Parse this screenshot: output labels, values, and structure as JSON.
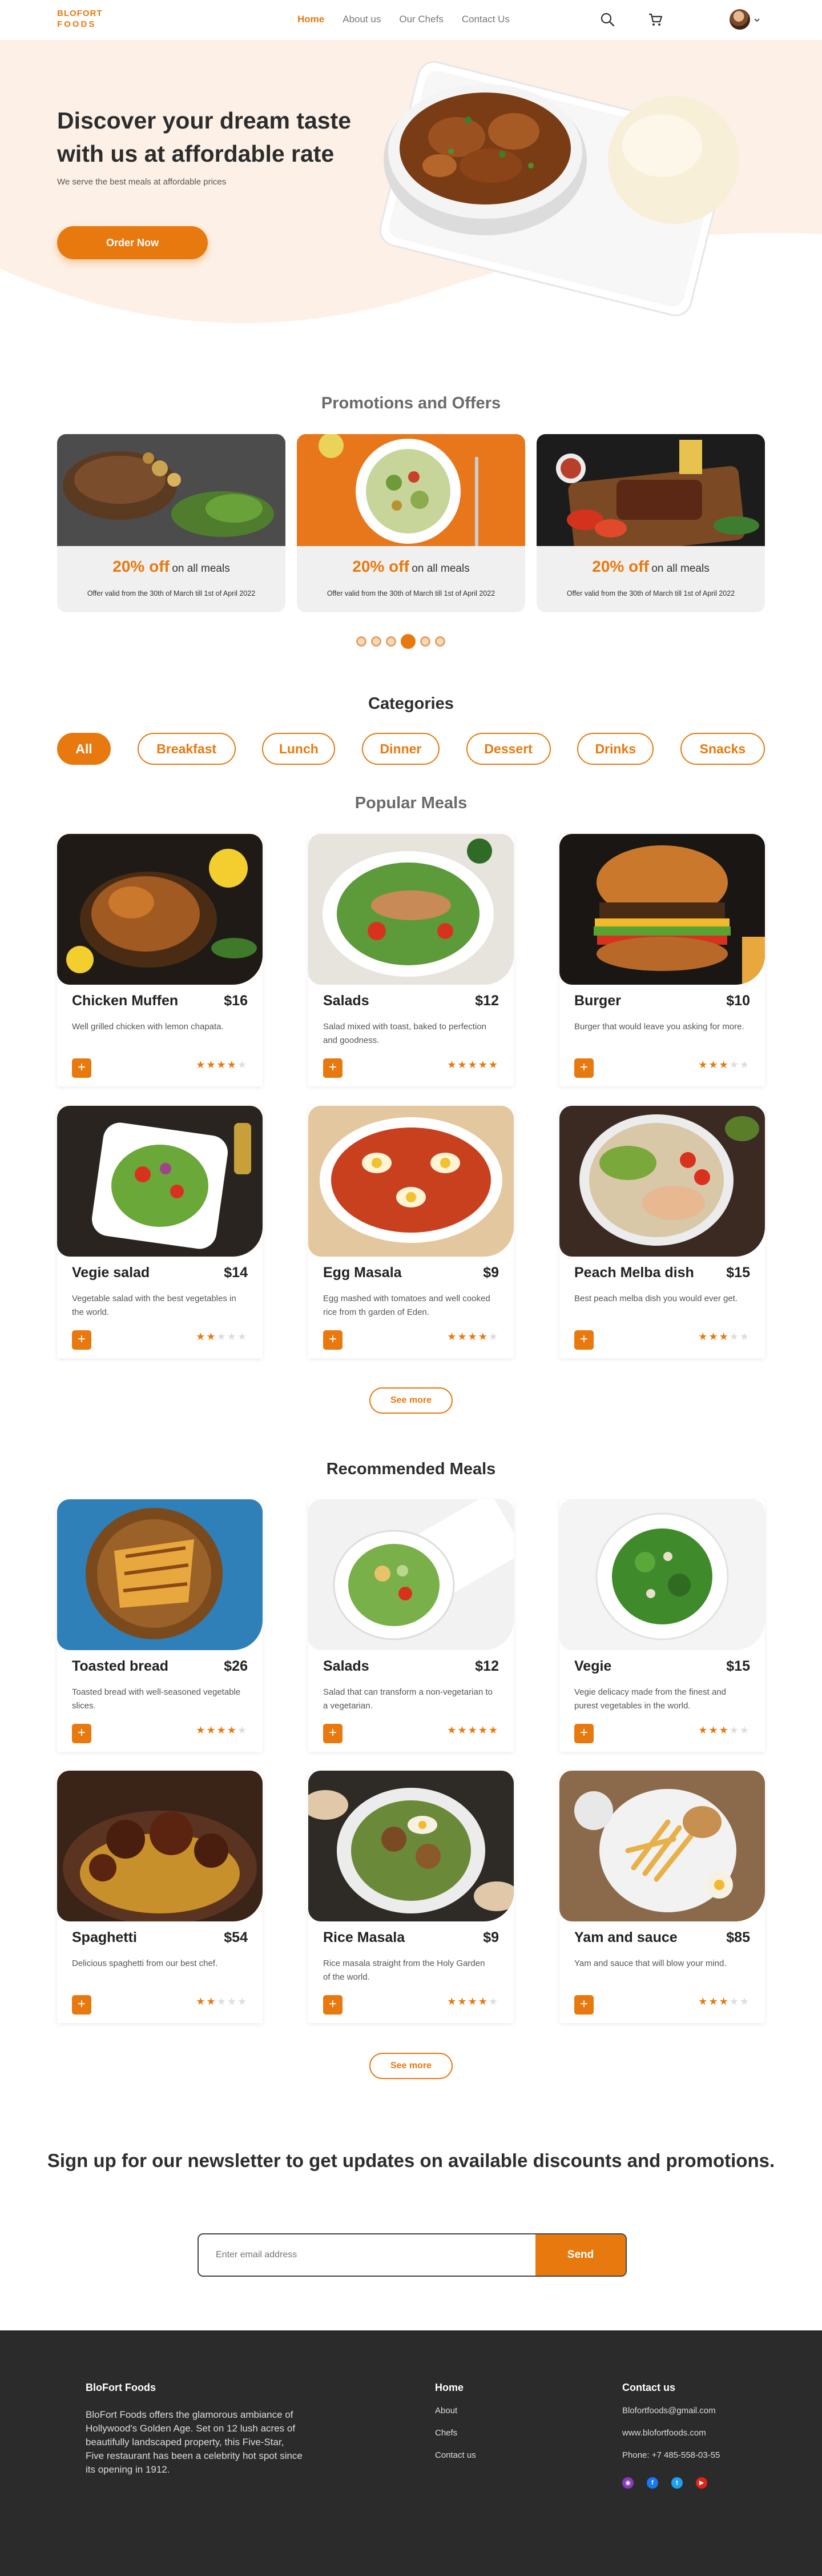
{
  "nav": {
    "logo_line1": "BLOFORT",
    "logo_line2": "FOODS",
    "links": [
      "Home",
      "About us",
      "Our Chefs",
      "Contact Us"
    ],
    "active": "Home"
  },
  "hero": {
    "title": "Discover your dream taste with us at affordable rate",
    "subtitle": "We serve the best meals at affordable prices",
    "button": "Order Now"
  },
  "promotions": {
    "title": "Promotions and Offers",
    "items": [
      {
        "percent": "20% off",
        "label": "on all meals",
        "valid": "Offer valid from the 30th of March till 1st of April 2022"
      },
      {
        "percent": "20% off",
        "label": "on all meals",
        "valid": "Offer valid from the 30th of March till 1st of April 2022"
      },
      {
        "percent": "20% off",
        "label": "on all meals",
        "valid": "Offer valid from the 30th of March till 1st of April 2022"
      }
    ],
    "slide_count": 6,
    "active_slide": 4
  },
  "categories": {
    "title": "Categories",
    "items": [
      "All",
      "Breakfast",
      "Lunch",
      "Dinner",
      "Dessert",
      "Drinks",
      "Snacks"
    ],
    "active": "All"
  },
  "popular": {
    "title": "Popular Meals",
    "see_more": "See more",
    "items": [
      {
        "name": "Chicken Muffen",
        "price": "$16",
        "desc": "Well grilled chicken with lemon chapata.",
        "rating": 4
      },
      {
        "name": "Salads",
        "price": "$12",
        "desc": "Salad mixed with toast, baked to perfection and goodness.",
        "rating": 5
      },
      {
        "name": "Burger",
        "price": "$10",
        "desc": "Burger that would leave you asking for more.",
        "rating": 3
      },
      {
        "name": "Vegie salad",
        "price": "$14",
        "desc": "Vegetable salad with the best vegetables in the world.",
        "rating": 2
      },
      {
        "name": "Egg Masala",
        "price": "$9",
        "desc": "Egg mashed with tomatoes and well cooked rice from th garden of Eden.",
        "rating": 4
      },
      {
        "name": "Peach Melba dish",
        "price": "$15",
        "desc": "Best peach melba dish you would ever get.",
        "rating": 3
      }
    ]
  },
  "recommended": {
    "title": "Recommended Meals",
    "see_more": "See more",
    "items": [
      {
        "name": "Toasted bread",
        "price": "$26",
        "desc": "Toasted bread with well-seasoned vegetable slices.",
        "rating": 4
      },
      {
        "name": "Salads",
        "price": "$12",
        "desc": "Salad that can transform a non-vegetarian to a vegetarian.",
        "rating": 5
      },
      {
        "name": "Vegie",
        "price": "$15",
        "desc": "Vegie delicacy made from the finest and purest vegetables in the world.",
        "rating": 3
      },
      {
        "name": "Spaghetti",
        "price": "$54",
        "desc": "Delicious spaghetti from our best chef.",
        "rating": 2
      },
      {
        "name": "Rice Masala",
        "price": "$9",
        "desc": "Rice masala straight from the Holy Garden of the world.",
        "rating": 4
      },
      {
        "name": "Yam and sauce",
        "price": "$85",
        "desc": "Yam and sauce that will blow your mind.",
        "rating": 3
      }
    ]
  },
  "newsletter": {
    "title": "Sign up for our newsletter to get updates on available discounts and promotions.",
    "placeholder": "Enter email address",
    "button": "Send"
  },
  "footer": {
    "brand": "BloFort Foods",
    "about": "BloFort Foods offers the glamorous ambiance of Hollywood's Golden Age. Set on 12 lush acres of beautifully landscaped property, this Five-Star, Five restaurant has been a celebrity hot spot since its opening in 1912.",
    "home_title": "Home",
    "home_links": [
      "About",
      "Chefs",
      "Contact us"
    ],
    "contact_title": "Contact us",
    "email": "Blofortfoods@gmail.com",
    "website": "www.blofortfoods.com",
    "phone": "Phone: +7 485-558-03-55",
    "social_colors": [
      "#8a3ab9",
      "#1877f2",
      "#1da1f2",
      "#e62117"
    ]
  },
  "colors": {
    "accent": "#e8790f",
    "hero_bg": "#fdf1e7",
    "footer_bg": "#2b2b2b"
  }
}
